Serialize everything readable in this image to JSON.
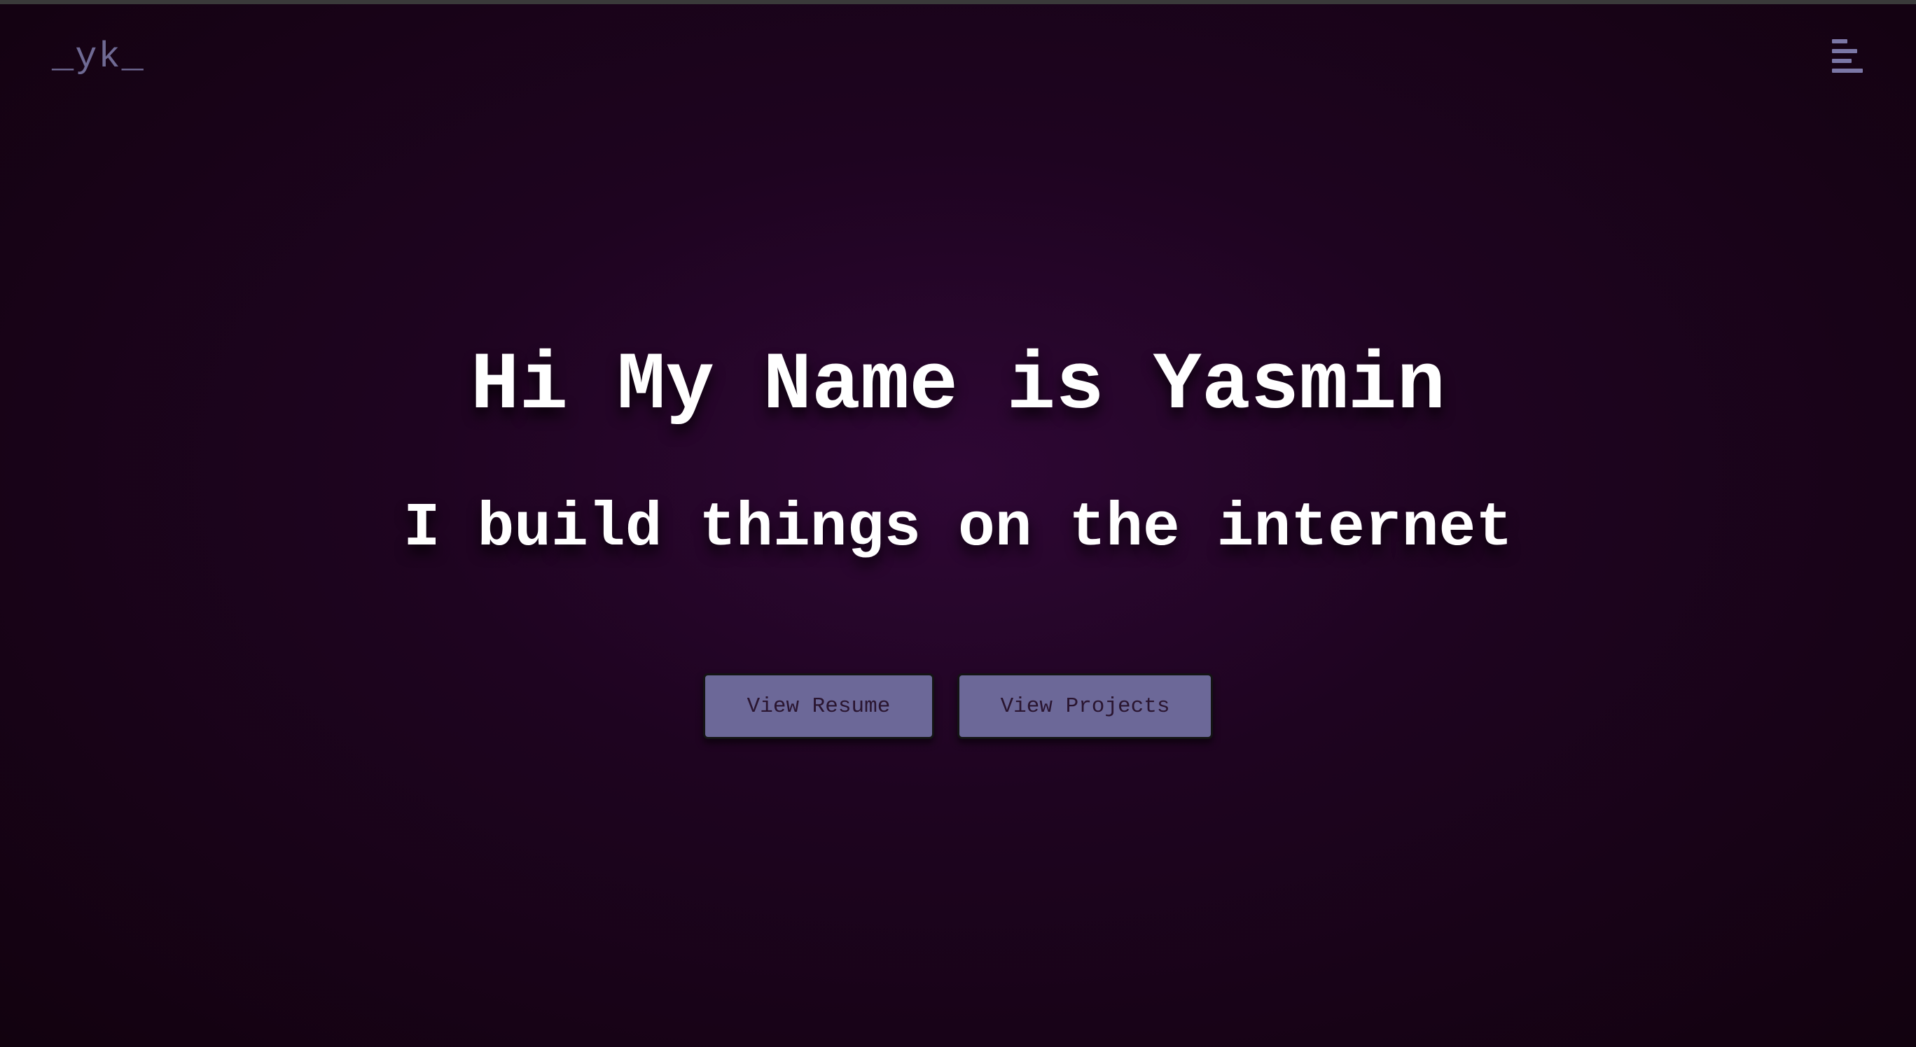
{
  "header": {
    "logo": "_yk_",
    "menu_icon": "hamburger-menu-icon"
  },
  "hero": {
    "title": "Hi My Name is Yasmin",
    "subtitle": "I build things on the internet"
  },
  "actions": {
    "resume_label": "View Resume",
    "projects_label": "View Projects"
  },
  "colors": {
    "background": "#1e0420",
    "accent": "#6c6898",
    "text": "#ffffff",
    "logo": "#6f6a94"
  }
}
